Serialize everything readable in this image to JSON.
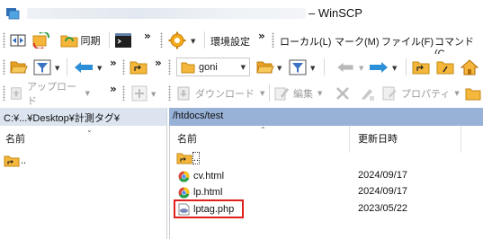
{
  "window": {
    "title": "– WinSCP"
  },
  "toolbar1": {
    "sync_label": "同期",
    "settings_label": "環境設定",
    "menu": [
      "ローカル(L)",
      "マーク(M)",
      "ファイル(F)",
      "コマンド(C"
    ]
  },
  "toolbar2": {
    "remote_dir": "goni"
  },
  "toolbar3": {
    "upload_label": "アップロード",
    "download_label": "ダウンロード",
    "edit_label": "編集",
    "properties_label": "プロパティ"
  },
  "local": {
    "path": "C:¥...¥Desktop¥計測タグ¥",
    "columns": {
      "name": "名前"
    },
    "files": [
      {
        "name": "..",
        "icon": "parent-folder-icon"
      }
    ]
  },
  "remote": {
    "path": "/htdocs/test",
    "columns": {
      "name": "名前",
      "modified": "更新日時"
    },
    "files": [
      {
        "name": "..",
        "date": "",
        "icon": "parent-folder-icon"
      },
      {
        "name": "cv.html",
        "date": "2024/09/17",
        "icon": "html-file-icon"
      },
      {
        "name": "lp.html",
        "date": "2024/09/17",
        "icon": "html-file-icon"
      },
      {
        "name": "lptag.php",
        "date": "2023/05/22",
        "icon": "php-file-icon"
      }
    ]
  },
  "colors": {
    "highlight": "#e0201e",
    "active_path_bar": "#97b2d6",
    "inactive_path_bar": "#dbe4ef"
  }
}
